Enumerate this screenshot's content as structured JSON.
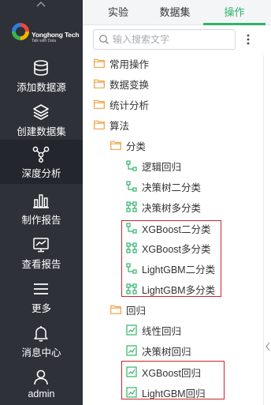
{
  "sidebar": {
    "logo": {
      "name": "Yonghong Tech",
      "tagline": "Talk with Data"
    },
    "items": [
      {
        "label": "添加数据源",
        "icon": "database-icon"
      },
      {
        "label": "创建数据集",
        "icon": "layers-icon"
      },
      {
        "label": "深度分析",
        "icon": "network-icon"
      },
      {
        "label": "制作报告",
        "icon": "bar-chart-icon"
      },
      {
        "label": "查看报告",
        "icon": "monitor-chart-icon"
      },
      {
        "label": "更多",
        "icon": "menu-icon"
      },
      {
        "label": "消息中心",
        "icon": "bell-icon"
      },
      {
        "label": "admin",
        "icon": "user-icon"
      }
    ],
    "active_item": "深度分析"
  },
  "tabs": [
    {
      "label": "实验"
    },
    {
      "label": "数据集"
    },
    {
      "label": "操作"
    }
  ],
  "active_tab": "操作",
  "search": {
    "placeholder": "输入搜索文字"
  },
  "tree": {
    "top_folders": [
      {
        "label": "常用操作"
      },
      {
        "label": "数据变换"
      },
      {
        "label": "统计分析"
      },
      {
        "label": "算法"
      }
    ],
    "algorithm_groups": [
      {
        "label": "分类",
        "items": [
          {
            "label": "逻辑回归"
          },
          {
            "label": "决策树二分类"
          },
          {
            "label": "决策树多分类"
          },
          {
            "label": "XGBoost二分类"
          },
          {
            "label": "XGBoost多分类"
          },
          {
            "label": "LightGBM二分类"
          },
          {
            "label": "LightGBM多分类"
          }
        ]
      },
      {
        "label": "回归",
        "items": [
          {
            "label": "线性回归"
          },
          {
            "label": "决策树回归"
          },
          {
            "label": "XGBoost回归"
          },
          {
            "label": "LightGBM回归"
          }
        ]
      }
    ]
  },
  "colors": {
    "sidebar_bg": "#2e3138",
    "sidebar_active_bg": "#23262c",
    "accent_green": "#2fb36a",
    "folder_orange": "#f0a040",
    "highlight_red": "#c8262b"
  }
}
